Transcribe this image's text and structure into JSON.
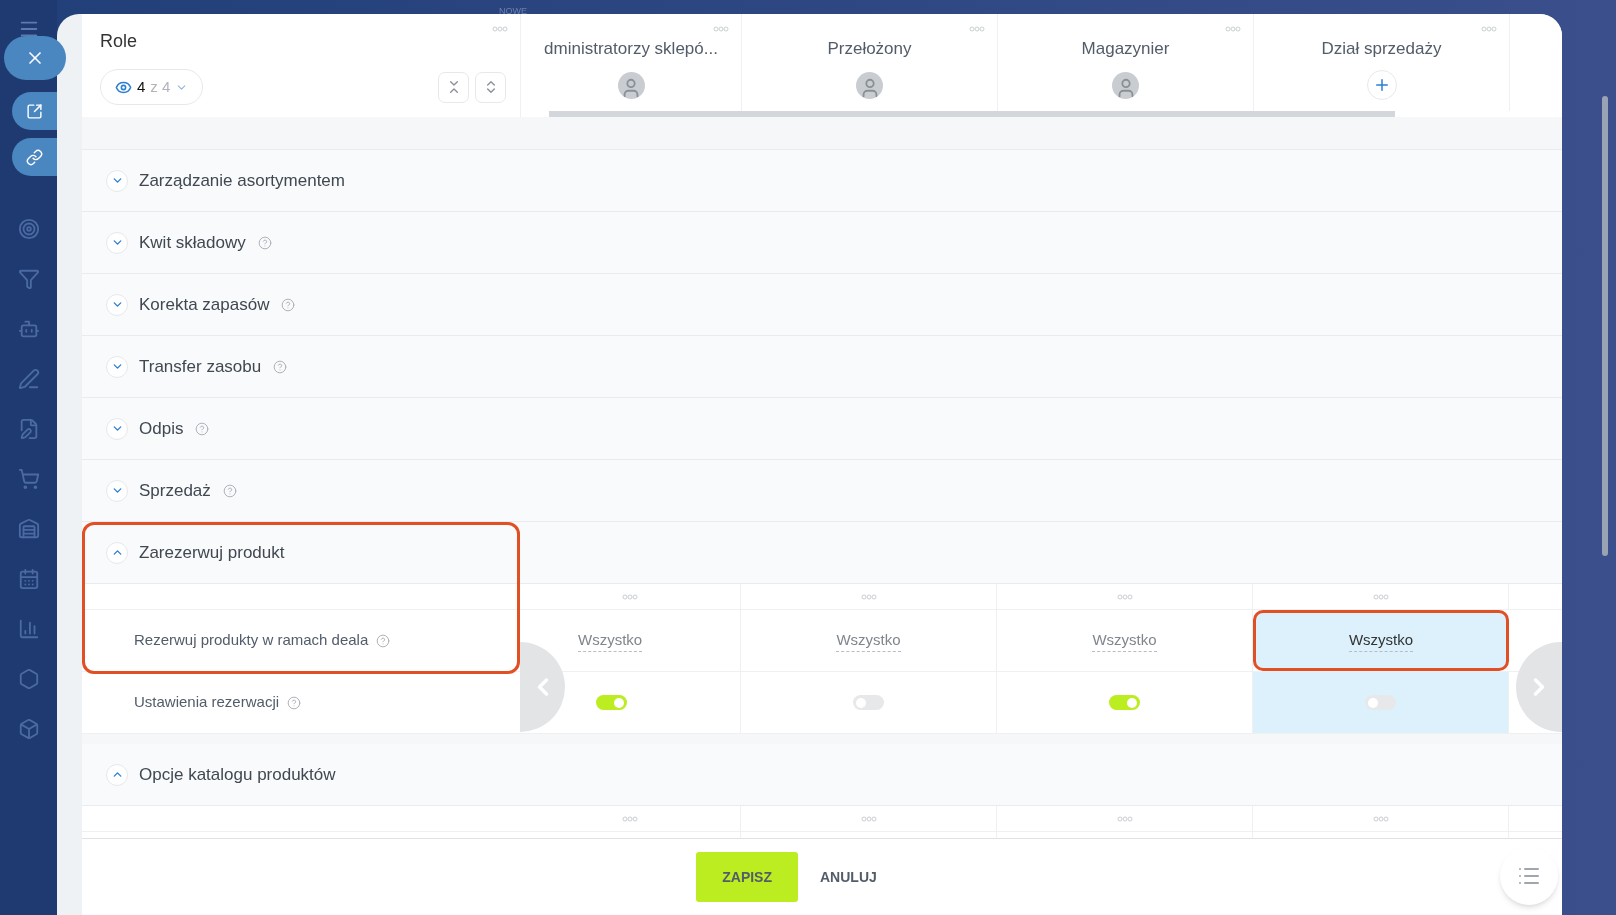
{
  "top_badge": "NOWE",
  "header": {
    "title": "Role",
    "visible_count": "4",
    "visible_total": "z 4"
  },
  "roles": [
    {
      "name": "dministratorzy sklepó...",
      "kind": "photo"
    },
    {
      "name": "Przełożony",
      "kind": "photo"
    },
    {
      "name": "Magazynier",
      "kind": "photo"
    },
    {
      "name": "Dział sprzedaży",
      "kind": "add"
    }
  ],
  "sections": [
    {
      "label": "Zarządzanie asortymentem",
      "expanded": false,
      "help": false,
      "annotated": false
    },
    {
      "label": "Kwit składowy",
      "expanded": false,
      "help": true,
      "annotated": false
    },
    {
      "label": "Korekta zapasów",
      "expanded": false,
      "help": true,
      "annotated": false
    },
    {
      "label": "Transfer zasobu",
      "expanded": false,
      "help": true,
      "annotated": false
    },
    {
      "label": "Odpis",
      "expanded": false,
      "help": true,
      "annotated": false
    },
    {
      "label": "Sprzedaż",
      "expanded": false,
      "help": true,
      "annotated": false
    },
    {
      "label": "Zarezerwuj produkt",
      "expanded": true,
      "help": false,
      "annotated": true,
      "rows": [
        {
          "label": "Rezerwuj produkty w ramach deala",
          "kind": "select",
          "cells": [
            {
              "value": "Wszystko",
              "selected": false,
              "annotated": false
            },
            {
              "value": "Wszystko",
              "selected": false,
              "annotated": false
            },
            {
              "value": "Wszystko",
              "selected": false,
              "annotated": false
            },
            {
              "value": "Wszystko",
              "selected": true,
              "annotated": true
            }
          ]
        },
        {
          "label": "Ustawienia rezerwacji",
          "kind": "toggle",
          "cells": [
            {
              "on": true,
              "selected": false
            },
            {
              "on": false,
              "selected": false
            },
            {
              "on": true,
              "selected": false
            },
            {
              "on": false,
              "selected": true
            }
          ]
        }
      ]
    },
    {
      "label": "Opcje katalogu produktów",
      "expanded": true,
      "help": false,
      "annotated": false
    }
  ],
  "footer": {
    "save": "ZAPISZ",
    "cancel": "ANULUJ"
  }
}
